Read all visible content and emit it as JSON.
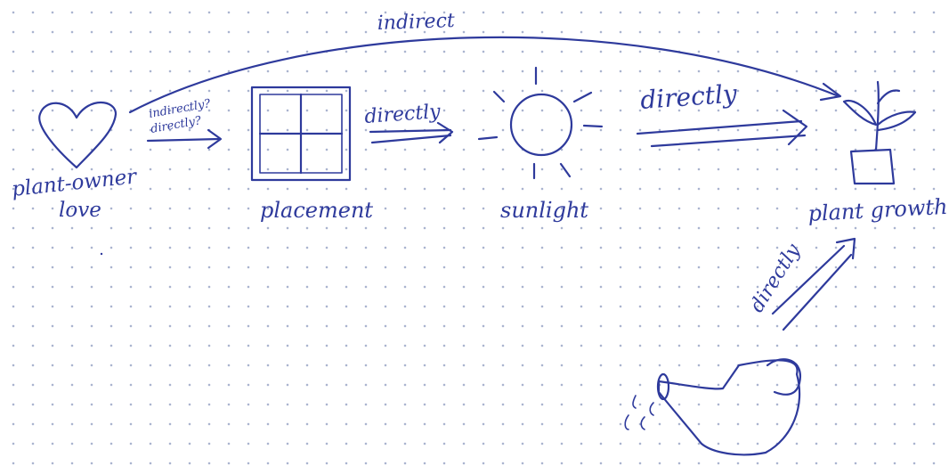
{
  "diagram": {
    "ink_color": "#2e3a9c",
    "background_dot_color": "#aab4cf",
    "nodes": {
      "love": {
        "label_line1": "plant-owner",
        "label_line2": "love",
        "icon": "heart-icon"
      },
      "placement": {
        "label": "placement",
        "icon": "window-icon"
      },
      "sunlight": {
        "label": "sunlight",
        "icon": "sun-icon"
      },
      "growth": {
        "label": "plant growth",
        "icon": "potted-plant-icon"
      },
      "water": {
        "label": "",
        "icon": "watering-can-icon"
      }
    },
    "edges": {
      "love_to_growth": "indirect",
      "love_to_placement_line1": "indirectly?",
      "love_to_placement_line2": "directly?",
      "placement_to_sunlight": "directly",
      "sunlight_to_growth": "directly",
      "water_to_growth": "directly"
    }
  }
}
